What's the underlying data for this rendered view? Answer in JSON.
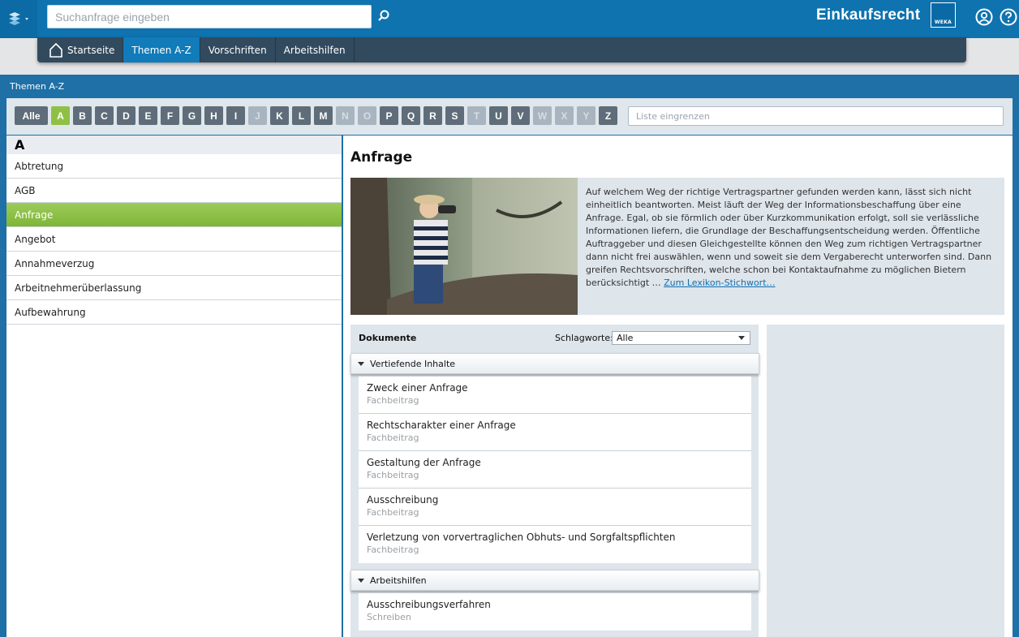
{
  "header": {
    "search_placeholder": "Suchanfrage eingeben",
    "brand": "Einkaufsrecht",
    "logo_text": "WEKA"
  },
  "nav": {
    "items": [
      {
        "label": "Startseite",
        "icon": "home-icon"
      },
      {
        "label": "Themen A-Z",
        "active": true
      },
      {
        "label": "Vorschriften"
      },
      {
        "label": "Arbeitshilfen"
      }
    ]
  },
  "panel": {
    "title": "Themen A-Z"
  },
  "alphabet": {
    "all_label": "Alle",
    "letters": [
      "A",
      "B",
      "C",
      "D",
      "E",
      "F",
      "G",
      "H",
      "I",
      "J",
      "K",
      "L",
      "M",
      "N",
      "O",
      "P",
      "Q",
      "R",
      "S",
      "T",
      "U",
      "V",
      "W",
      "X",
      "Y",
      "Z"
    ],
    "disabled": [
      "J",
      "N",
      "O",
      "T",
      "W",
      "X",
      "Y"
    ],
    "active": "A",
    "filter_placeholder": "Liste eingrenzen"
  },
  "left": {
    "heading": "A",
    "items": [
      "Abtretung",
      "AGB",
      "Anfrage",
      "Angebot",
      "Annahmeverzug",
      "Arbeitnehmerüberlassung",
      "Aufbewahrung"
    ],
    "selected": "Anfrage"
  },
  "right": {
    "title": "Anfrage",
    "intro_text": "Auf welchem Weg der richtige Vertragspartner gefunden werden kann, lässt sich nicht einheitlich beantworten. Meist läuft der Weg der Informationsbeschaffung über eine Anfrage. Egal, ob sie förmlich oder über Kurzkommunikation erfolgt, soll sie verlässliche Informationen liefern, die Grundlage der Beschaffungsentscheidung werden. Öffentliche Auftraggeber und diesen Gleichgestellte können den Weg zum richtigen Vertragspartner dann nicht frei auswählen, wenn und soweit sie dem Vergaberecht unterworfen sind. Dann greifen Rechtsvorschriften, welche schon bei Kontaktaufnahme zu möglichen Bietern berücksichtigt …",
    "intro_link": "Zum Lexikon-Stichwort…",
    "docs_label": "Dokumente",
    "keywords_label": "Schlagworte:",
    "keywords_value": "Alle",
    "sections": [
      {
        "title": "Vertiefende Inhalte",
        "docs": [
          {
            "title": "Zweck einer Anfrage",
            "type": "Fachbeitrag"
          },
          {
            "title": "Rechtscharakter einer Anfrage",
            "type": "Fachbeitrag"
          },
          {
            "title": "Gestaltung der Anfrage",
            "type": "Fachbeitrag"
          },
          {
            "title": "Ausschreibung",
            "type": "Fachbeitrag"
          },
          {
            "title": "Verletzung von vorvertraglichen Obhuts- und Sorgfaltspflichten",
            "type": "Fachbeitrag"
          }
        ]
      },
      {
        "title": "Arbeitshilfen",
        "docs": [
          {
            "title": "Ausschreibungsverfahren",
            "type": "Schreiben"
          }
        ]
      }
    ]
  }
}
